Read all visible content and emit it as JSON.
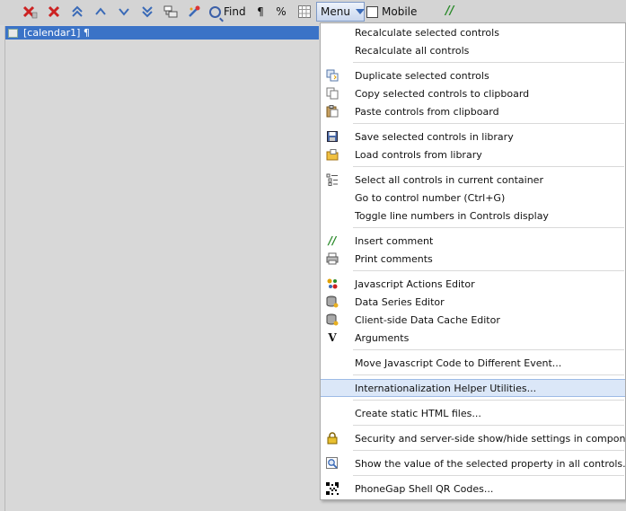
{
  "toolbar": {
    "find_label": "Find",
    "pilcrow": "¶",
    "percent": "%",
    "menu_label": "Menu",
    "mobile_label": "Mobile",
    "comment_glyph": "//"
  },
  "tree": {
    "selected_item": "[calendar1] ¶"
  },
  "menu": {
    "items": [
      {
        "label": "Recalculate selected controls",
        "icon": ""
      },
      {
        "label": "Recalculate all controls",
        "icon": ""
      },
      {
        "label": "Duplicate selected controls",
        "icon": "duplicate-icon"
      },
      {
        "label": "Copy selected controls to clipboard",
        "icon": "copy-icon"
      },
      {
        "label": "Paste controls from clipboard",
        "icon": "paste-icon"
      },
      {
        "label": "Save selected controls in library",
        "icon": "save-icon"
      },
      {
        "label": "Load controls from library",
        "icon": "folder-icon"
      },
      {
        "label": "Select all controls in current container",
        "icon": "select-all-icon"
      },
      {
        "label": "Go to control number (Ctrl+G)",
        "icon": ""
      },
      {
        "label": "Toggle line numbers in Controls display",
        "icon": ""
      },
      {
        "label": "Insert comment",
        "icon": "comment-icon"
      },
      {
        "label": "Print comments",
        "icon": "printer-icon"
      },
      {
        "label": "Javascript Actions Editor",
        "icon": "actions-icon"
      },
      {
        "label": "Data Series Editor",
        "icon": "database-icon"
      },
      {
        "label": "Client-side Data Cache Editor",
        "icon": "database-icon"
      },
      {
        "label": "Arguments",
        "icon": "v-icon"
      },
      {
        "label": "Move Javascript Code to Different Event...",
        "icon": ""
      },
      {
        "label": "Internationalization Helper Utilities...",
        "icon": ""
      },
      {
        "label": "Create static HTML files...",
        "icon": ""
      },
      {
        "label": "Security and server-side show/hide settings in component...",
        "icon": "lock-icon"
      },
      {
        "label": "Show the value of the selected property in all controls...",
        "icon": "magnifier-icon"
      },
      {
        "label": "PhoneGap Shell QR Codes...",
        "icon": "qr-code-icon"
      }
    ]
  },
  "colors": {
    "selection": "#3b73c7",
    "menu_highlight": "#dbe7f8",
    "delete_red": "#cc2222",
    "arrow_blue": "#3a6ab7"
  }
}
